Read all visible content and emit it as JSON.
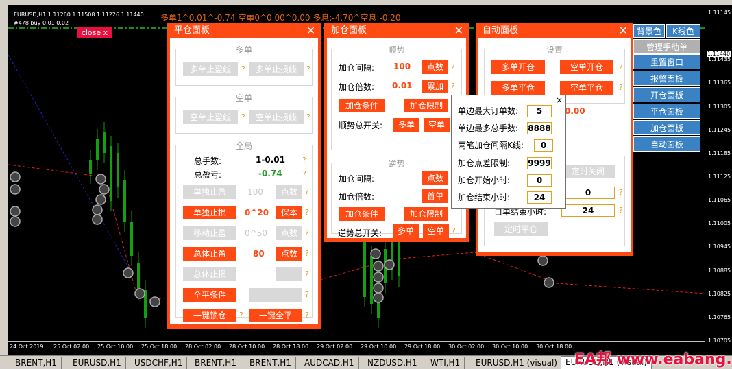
{
  "chart": {
    "symbol_info": "EURUSD,H1  1.11260 1.11508 1.11226 1.11440",
    "trade_info": "#478 buy 0.01 0.02",
    "stats": "多单1^0.01^-0.74  空单0^0.00^0.00  多息:-4.70^空息:-0.20",
    "close_label": "close x",
    "price_ticks": [
      "1.11145",
      "1.11440",
      "1.11435",
      "1.11365",
      "1.11305",
      "1.11245",
      "1.11185",
      "1.11125",
      "1.11065",
      "1.11005",
      "1.10945",
      "1.10885",
      "1.10825",
      "1.10765",
      "1.10705"
    ],
    "time_ticks": [
      "24 Oct 2019",
      "25 Oct 02:00",
      "25 Oct 10:00",
      "25 Oct 18:00",
      "28 Oct 02:00",
      "28 Oct 10:00",
      "28 Oct 18:00",
      "29 Oct 02:00",
      "29 Oct 10:00",
      "29 Oct 18:00",
      "30 Oct 02:00",
      "30 Oct 10:00",
      "30 Oct 18:00"
    ],
    "colors": {
      "candle": "#10a010",
      "dash_red": "#e02020",
      "dash_blue": "#2020e0",
      "dash_green": "#20c020"
    }
  },
  "close_panel": {
    "title": "平仓面板",
    "close_icon": "close-icon",
    "long_group": "多单",
    "long_tp": "多单止盈线",
    "long_sl": "多单止损线",
    "short_group": "空单",
    "short_tp": "空单止盈线",
    "short_sl": "空单止损线",
    "global_group": "全局",
    "total_lots_label": "总手数:",
    "total_lots_value": "1-0.01",
    "total_pnl_label": "总盈亏:",
    "total_pnl_value": "-0.74",
    "single_tp": "单独止盈",
    "single_tp_value": "100",
    "points_btn": "点数",
    "single_sl": "单独止损",
    "single_sl_value": "0^20",
    "breakeven_btn": "保本",
    "trailing_stop": "移动止盈",
    "trailing_value": "0^50",
    "total_tp": "总体止盈",
    "total_tp_value": "80",
    "total_sl": "总体止损",
    "close_all_cond": "全平条件",
    "one_key_lock": "一键锁仓",
    "one_key_close": "一键全平",
    "help": "?"
  },
  "add_panel": {
    "title": "加仓面板",
    "trend_group": "顺势",
    "interval_label": "加仓间隔:",
    "interval_value": "100",
    "points_btn": "点数",
    "multiplier_label": "加仓倍数:",
    "multiplier_value": "0.01",
    "accumulate_btn": "累加",
    "add_condition": "加仓条件",
    "add_limit": "加仓限制",
    "trend_switch_label": "顺势总开关:",
    "long_btn": "多单",
    "short_btn": "空单",
    "counter_group": "逆势",
    "counter_interval_label": "加仓间隔:",
    "counter_points_btn": "点数",
    "counter_multiplier_label": "加仓倍数:",
    "counter_multiplier_btn": "首单",
    "counter_add_condition": "加仓条件",
    "counter_add_limit": "加仓限制",
    "counter_switch_label": "逆势总开关:",
    "counter_long_btn": "多单",
    "counter_short_btn": "空单"
  },
  "auto_panel": {
    "title": "自动面板",
    "settings_group": "设置",
    "long_open": "多单开仓",
    "short_open": "空单开仓",
    "long_close": "多单平仓",
    "short_close": "空单平仓",
    "value_000": "0.00",
    "timed_close": "定时关闭",
    "value_0": "0",
    "end_hour_label": "自单结束小时:",
    "value_24": "24",
    "timed_flat": "定时平仓"
  },
  "popup": {
    "close_icon": "×",
    "rows": [
      {
        "label": "单边最大订单数:",
        "value": "5"
      },
      {
        "label": "单边最多总手数:",
        "value": "8888"
      },
      {
        "label": "两笔加仓间隔K线:",
        "value": "0"
      },
      {
        "label": "加仓点差限制:",
        "value": "9999"
      },
      {
        "label": "加仓开始小时:",
        "value": "0"
      },
      {
        "label": "加仓结束小时:",
        "value": "24"
      }
    ]
  },
  "right_menu": {
    "bg_color": "背景色",
    "k_color": "K线色",
    "items": [
      "管理手动单",
      "重置窗口",
      "报警面板",
      "开仓面板",
      "平仓面板",
      "加仓面板",
      "自动面板"
    ]
  },
  "tabs": [
    "BRENT,H1",
    "EURUSD,H1",
    "USDCHF,H1",
    "BRENT,H1",
    "BRENT,H1",
    "AUDCAD,H1",
    "NZDUSD,H1",
    "WTI,H1",
    "EURUSD,H1 (visual)",
    "EURUSD,H1 (visual)"
  ],
  "watermark": "EA邦 www.eabang.com"
}
